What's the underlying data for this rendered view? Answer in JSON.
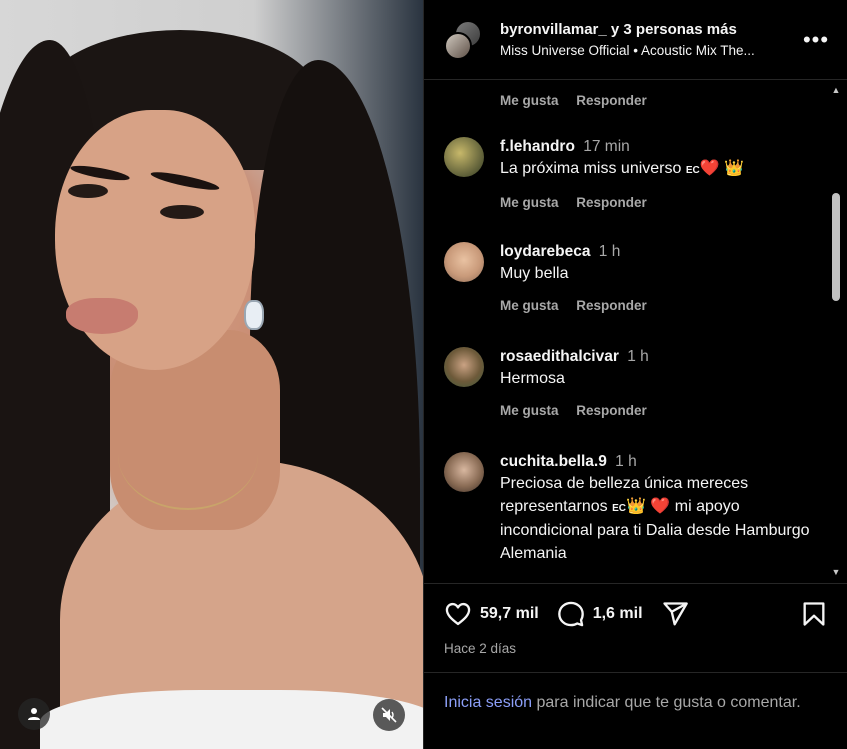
{
  "post": {
    "header": {
      "user": "byronvillamar_",
      "coauthors": "y 3 personas más",
      "subtitle": "Miss Universe Official • Acoustic Mix The...",
      "more_icon": "more-horizontal-icon"
    },
    "top_actions": {
      "like": "Me gusta",
      "reply": "Responder"
    },
    "comments": [
      {
        "user": "f.lehandro",
        "time": "17 min",
        "text": "La próxima miss universo",
        "flag": "EC",
        "emojis": [
          "❤️",
          "👑"
        ],
        "like": "Me gusta",
        "reply": "Responder",
        "avatar_color": "#6b6a3f"
      },
      {
        "user": "loydarebeca",
        "time": "1 h",
        "text": "Muy bella",
        "like": "Me gusta",
        "reply": "Responder",
        "avatar_color": "#c99a7a"
      },
      {
        "user": "rosaedithalcivar",
        "time": "1 h",
        "text": "Hermosa",
        "like": "Me gusta",
        "reply": "Responder",
        "avatar_color": "#6e5a3a"
      },
      {
        "user": "cuchita.bella.9",
        "time": "1 h",
        "text_part1": "Preciosa de belleza única mereces representarnos",
        "flag": "EC",
        "text_part2": "mi apoyo incondicional para ti Dalia desde Hamburgo Alemania",
        "emojis": [
          "👑",
          "❤️"
        ],
        "avatar_color": "#8a6c55"
      }
    ],
    "actions": {
      "likes": "59,7 mil",
      "comments": "1,6 mil",
      "like_icon": "heart-icon",
      "comment_icon": "comment-icon",
      "share_icon": "send-icon",
      "save_icon": "bookmark-icon"
    },
    "date": "Hace 2 días",
    "footer": {
      "login_link": "Inicia sesión",
      "rest": " para indicar que te gusta o comentar."
    }
  },
  "colors": {
    "background": "#000000",
    "text_primary": "#f5f5f5",
    "text_secondary": "#a8a8a8",
    "link": "#8c9ff8",
    "heart": "#e4233d"
  }
}
